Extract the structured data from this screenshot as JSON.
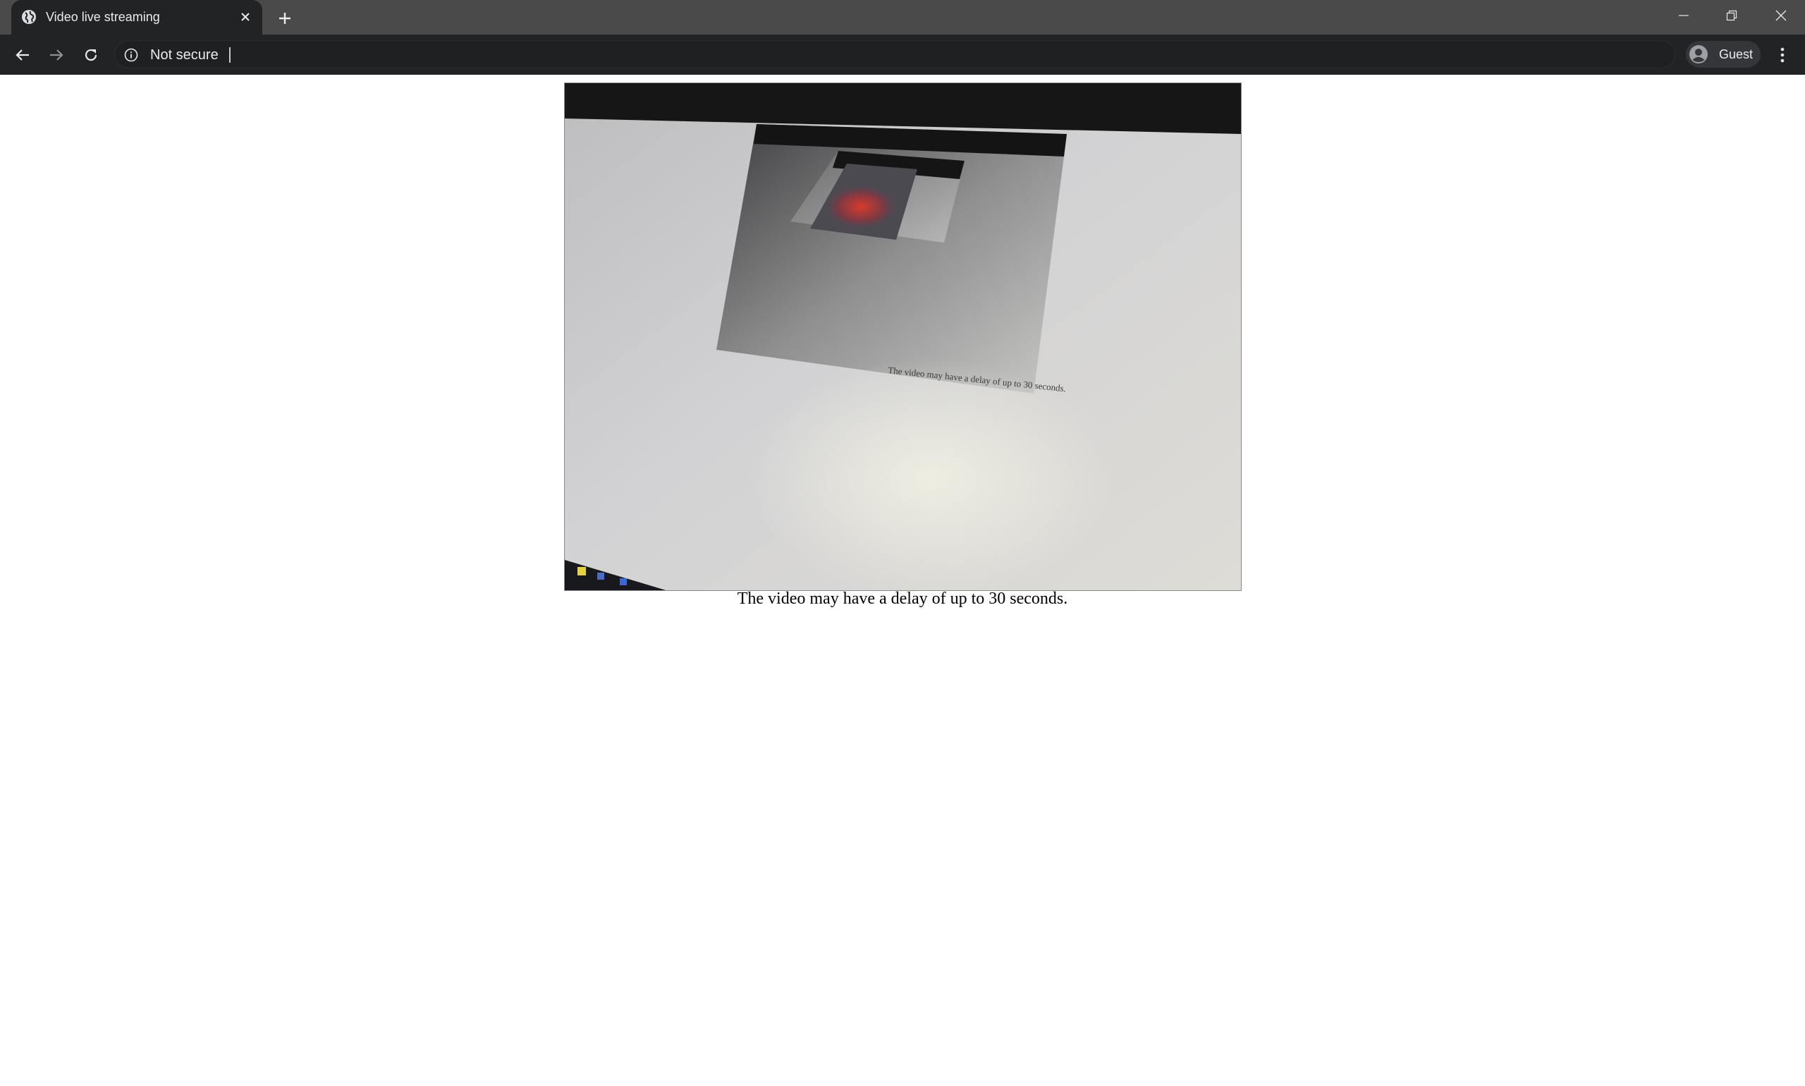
{
  "browser": {
    "tab": {
      "title": "Video live streaming",
      "favicon_icon": "globe-icon",
      "close_icon": "close-icon"
    },
    "new_tab_icon": "plus-icon",
    "window_controls": {
      "minimize_icon": "minimize-icon",
      "restore_icon": "restore-icon",
      "close_icon": "close-icon"
    },
    "toolbar": {
      "back_icon": "arrow-left-icon",
      "forward_icon": "arrow-right-icon",
      "reload_icon": "reload-icon",
      "security_icon": "info-icon",
      "security_label": "Not secure",
      "url_value": "",
      "profile_label": "Guest",
      "profile_icon": "account-circle-icon",
      "menu_icon": "kebab-menu-icon"
    }
  },
  "page": {
    "video_frame": {
      "kind": "live camera stream showing a monitor displaying the same page",
      "inner_caption": "The video may have a delay of up to 30 seconds."
    },
    "caption": "The video may have a delay of up to 30 seconds."
  },
  "colors": {
    "titlebar": "#4a4a4a",
    "toolbar": "#222325",
    "text_light": "#e8eaed",
    "page_bg": "#ffffff"
  }
}
